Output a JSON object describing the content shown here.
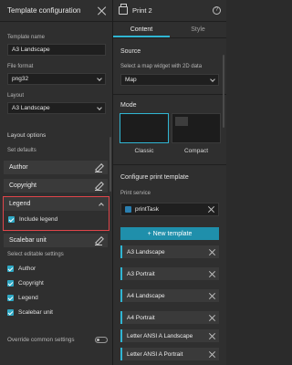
{
  "left_panel": {
    "title": "Template configuration",
    "template_name_label": "Template name",
    "template_name_value": "A3 Landscape",
    "file_format_label": "File format",
    "file_format_value": "png32",
    "layout_label": "Layout",
    "layout_value": "A3 Landscape",
    "layout_options_title": "Layout options",
    "set_defaults_label": "Set defaults",
    "defaults": [
      {
        "label": "Author"
      },
      {
        "label": "Copyright"
      },
      {
        "label": "Legend",
        "expanded": true
      },
      {
        "label": "Scalebar unit"
      }
    ],
    "include_legend_label": "Include legend",
    "editable_settings_label": "Select editable settings",
    "editable_settings": [
      "Author",
      "Copyright",
      "Legend",
      "Scalebar unit"
    ],
    "override_label": "Override common settings"
  },
  "right_panel": {
    "title": "Print 2",
    "tabs": [
      {
        "label": "Content",
        "active": true
      },
      {
        "label": "Style",
        "active": false
      }
    ],
    "source_title": "Source",
    "source_hint": "Select a map widget with 2D data",
    "source_value": "Map",
    "mode_title": "Mode",
    "modes": [
      {
        "label": "Classic",
        "selected": true
      },
      {
        "label": "Compact",
        "selected": false
      }
    ],
    "configure_title": "Configure print template",
    "print_service_label": "Print service",
    "print_service_value": "printTask",
    "new_template_label": "+ New template",
    "templates": [
      "A3 Landscape",
      "A3 Portrait",
      "A4 Landscape",
      "A4 Portrait",
      "Letter ANSI A Landscape",
      "Letter ANSI A Portrait"
    ]
  },
  "colors": {
    "accent": "#30b6d3",
    "highlight": "#e0454a",
    "panel": "#2f2f2f"
  }
}
